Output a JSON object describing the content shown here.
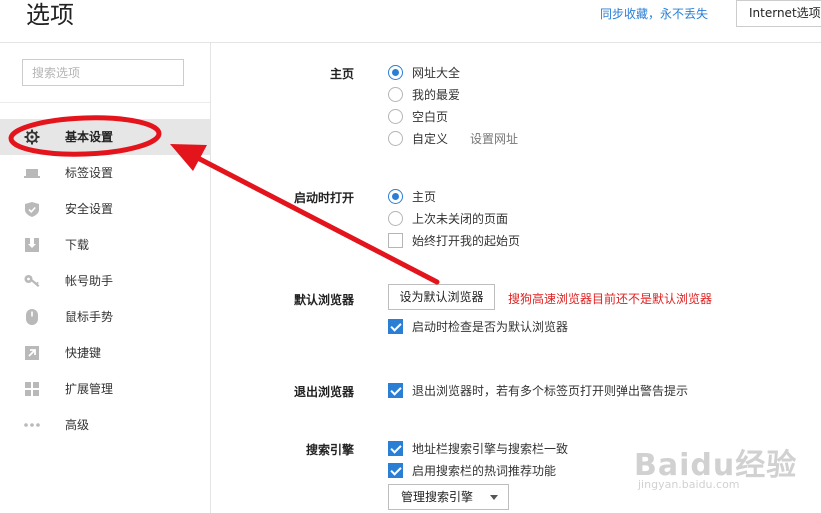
{
  "header": {
    "title": "选项",
    "sync_link": "同步收藏，永不丢失",
    "ie_options_button": "Internet选项"
  },
  "sidebar": {
    "search_placeholder": "搜索选项",
    "items": [
      {
        "label": "基本设置",
        "icon": "gear-icon",
        "active": true
      },
      {
        "label": "标签设置",
        "icon": "tab-icon",
        "active": false
      },
      {
        "label": "安全设置",
        "icon": "shield-icon",
        "active": false
      },
      {
        "label": "下载",
        "icon": "download-icon",
        "active": false
      },
      {
        "label": "帐号助手",
        "icon": "key-icon",
        "active": false
      },
      {
        "label": "鼠标手势",
        "icon": "mouse-icon",
        "active": false
      },
      {
        "label": "快捷键",
        "icon": "shortcut-arrow-icon",
        "active": false
      },
      {
        "label": "扩展管理",
        "icon": "extensions-grid-icon",
        "active": false
      },
      {
        "label": "高级",
        "icon": "more-dots-icon",
        "active": false
      }
    ]
  },
  "main": {
    "homepage": {
      "label": "主页",
      "options": [
        {
          "label": "网址大全",
          "selected": true
        },
        {
          "label": "我的最爱",
          "selected": false
        },
        {
          "label": "空白页",
          "selected": false
        },
        {
          "label": "自定义",
          "selected": false
        }
      ],
      "set_url_link": "设置网址"
    },
    "startup": {
      "label": "启动时打开",
      "options": [
        {
          "label": "主页",
          "selected": true
        },
        {
          "label": "上次未关闭的页面",
          "selected": false
        }
      ],
      "always_open_start": {
        "label": "始终打开我的起始页",
        "checked": false
      }
    },
    "default_browser": {
      "label": "默认浏览器",
      "set_default_button": "设为默认浏览器",
      "warning": "搜狗高速浏览器目前还不是默认浏览器",
      "check_on_startup": {
        "label": "启动时检查是否为默认浏览器",
        "checked": true
      }
    },
    "exit_browser": {
      "label": "退出浏览器",
      "warn_on_exit": {
        "label": "退出浏览器时，若有多个标签页打开则弹出警告提示",
        "checked": true
      }
    },
    "search_engine": {
      "label": "搜索引擎",
      "sync_search": {
        "label": "地址栏搜索引擎与搜索栏一致",
        "checked": true
      },
      "hot_words": {
        "label": "启用搜索栏的热词推荐功能",
        "checked": true
      },
      "manage_button": "管理搜索引擎"
    }
  },
  "annotation": {
    "color": "#e3141b"
  },
  "watermark": {
    "logo": "Baidu经验",
    "sub": "jingyan.baidu.com"
  },
  "colors": {
    "accent": "#2a7fd4",
    "warning": "#e02020",
    "active_bg": "#e6e6e6"
  }
}
